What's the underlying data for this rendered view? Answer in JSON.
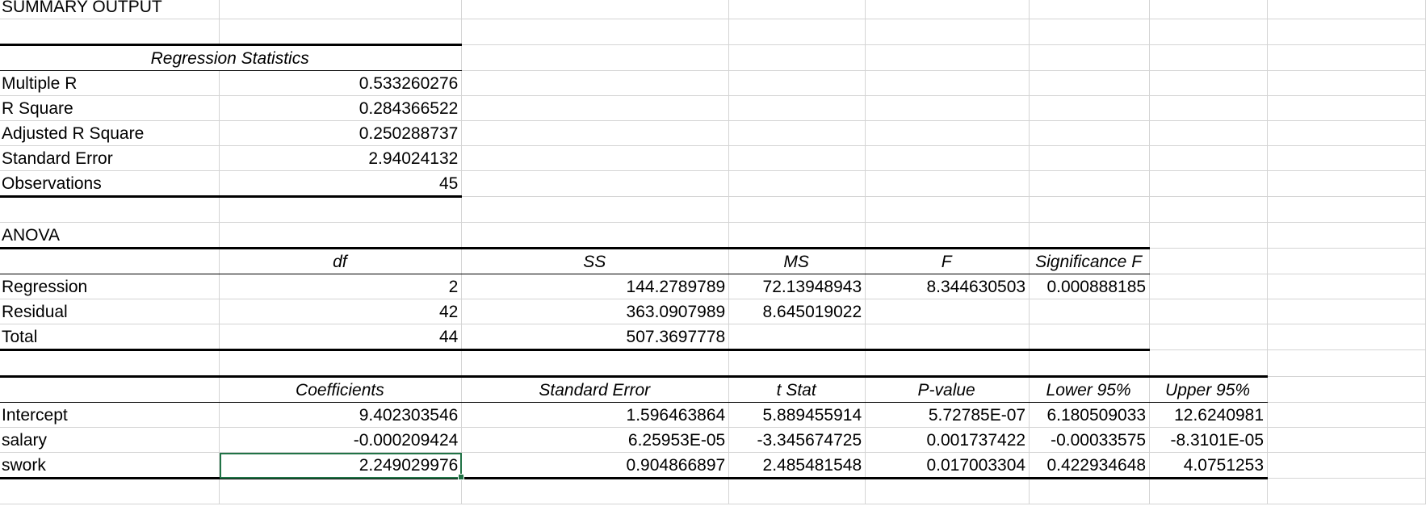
{
  "title": "SUMMARY OUTPUT",
  "regression_stats": {
    "header": "Regression Statistics",
    "rows": [
      {
        "label": "Multiple R",
        "value": "0.533260276"
      },
      {
        "label": "R Square",
        "value": "0.284366522"
      },
      {
        "label": "Adjusted R Square",
        "value": "0.250288737"
      },
      {
        "label": "Standard Error",
        "value": "2.94024132"
      },
      {
        "label": "Observations",
        "value": "45"
      }
    ]
  },
  "anova": {
    "title": "ANOVA",
    "headers": [
      "df",
      "SS",
      "MS",
      "F",
      "Significance F"
    ],
    "rows": [
      {
        "label": "Regression",
        "df": "2",
        "ss": "144.2789789",
        "ms": "72.13948943",
        "f": "8.344630503",
        "sig_f": "0.000888185"
      },
      {
        "label": "Residual",
        "df": "42",
        "ss": "363.0907989",
        "ms": "8.645019022",
        "f": "",
        "sig_f": ""
      },
      {
        "label": "Total",
        "df": "44",
        "ss": "507.3697778",
        "ms": "",
        "f": "",
        "sig_f": ""
      }
    ]
  },
  "coefficients": {
    "headers": [
      "Coefficients",
      "Standard Error",
      "t Stat",
      "P-value",
      "Lower 95%",
      "Upper 95%"
    ],
    "rows": [
      {
        "label": "Intercept",
        "coef": "9.402303546",
        "se": "1.596463864",
        "t": "5.889455914",
        "p": "5.72785E-07",
        "lower": "6.180509033",
        "upper": "12.6240981"
      },
      {
        "label": "salary",
        "coef": "-0.000209424",
        "se": "6.25953E-05",
        "t": "-3.345674725",
        "p": "0.001737422",
        "lower": "-0.00033575",
        "upper": "-8.3101E-05"
      },
      {
        "label": "swork",
        "coef": "2.249029976",
        "se": "0.904866897",
        "t": "2.485481548",
        "p": "0.017003304",
        "lower": "0.422934648",
        "upper": "4.0751253"
      }
    ]
  },
  "colors": {
    "gridline": "#d4d4d4",
    "selection": "#217346"
  }
}
